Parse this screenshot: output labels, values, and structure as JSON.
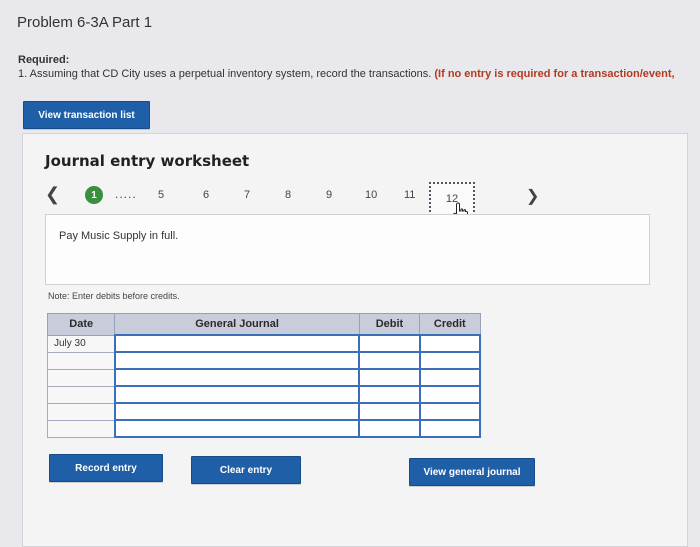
{
  "header": {
    "title": "Problem 6-3A Part 1",
    "required_label": "Required:",
    "required_text": "1. Assuming that CD City uses a perpetual inventory system, record the transactions.",
    "required_warning": "(If no entry is required for a transaction/event,"
  },
  "buttons": {
    "view_transaction_list": "View transaction list",
    "record_entry": "Record entry",
    "clear_entry": "Clear entry",
    "view_general_journal": "View general journal"
  },
  "worksheet": {
    "title": "Journal entry worksheet",
    "nav": {
      "active": "1",
      "dots": ".....",
      "pages": [
        "5",
        "6",
        "7",
        "8",
        "9",
        "10",
        "11"
      ],
      "current": "12"
    },
    "description": "Pay Music Supply in full.",
    "note": "Note: Enter debits before credits."
  },
  "journal": {
    "headers": {
      "date": "Date",
      "general_journal": "General Journal",
      "debit": "Debit",
      "credit": "Credit"
    },
    "rows": [
      {
        "date": "July 30",
        "account": "",
        "debit": "",
        "credit": ""
      },
      {
        "date": "",
        "account": "",
        "debit": "",
        "credit": ""
      },
      {
        "date": "",
        "account": "",
        "debit": "",
        "credit": ""
      },
      {
        "date": "",
        "account": "",
        "debit": "",
        "credit": ""
      },
      {
        "date": "",
        "account": "",
        "debit": "",
        "credit": ""
      },
      {
        "date": "",
        "account": "",
        "debit": "",
        "credit": ""
      }
    ]
  },
  "colors": {
    "button_blue": "#1f5fa8",
    "active_step_green": "#3a8f3e",
    "header_bg": "#c9ccdb",
    "warning_red": "#b33b1e"
  },
  "icons": {
    "prev": "chevron-left-icon",
    "next": "chevron-right-icon",
    "cursor": "hand-pointer-icon"
  }
}
